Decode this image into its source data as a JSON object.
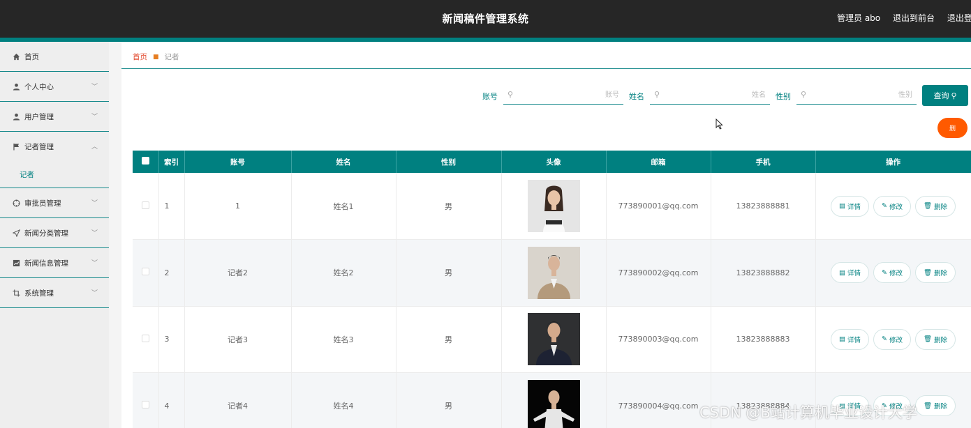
{
  "header": {
    "title": "新闻稿件管理系统",
    "user_label": "管理员 abo",
    "to_front_label": "退出到前台",
    "logout_label": "退出登录"
  },
  "sidebar": {
    "items": [
      {
        "label": "首页",
        "icon": "home-icon"
      },
      {
        "label": "个人中心",
        "icon": "user-icon"
      },
      {
        "label": "用户管理",
        "icon": "user-icon"
      },
      {
        "label": "记者管理",
        "icon": "flag-icon",
        "expanded": true,
        "children": [
          "记者"
        ]
      },
      {
        "label": "审批员管理",
        "icon": "target-icon"
      },
      {
        "label": "新闻分类管理",
        "icon": "send-icon"
      },
      {
        "label": "新闻信息管理",
        "icon": "chart-icon"
      },
      {
        "label": "系统管理",
        "icon": "crop-icon"
      }
    ]
  },
  "breadcrumb": {
    "home": "首页",
    "current": "记者"
  },
  "search": {
    "account_label": "账号",
    "account_placeholder": "账号",
    "name_label": "姓名",
    "name_placeholder": "姓名",
    "gender_label": "性别",
    "gender_placeholder": "性别",
    "query_label": "查询",
    "delete_label": "删"
  },
  "table": {
    "headers": [
      "索引",
      "账号",
      "姓名",
      "性别",
      "头像",
      "邮箱",
      "手机",
      "操作"
    ],
    "rows": [
      {
        "index": "1",
        "account": "1",
        "name": "姓名1",
        "gender": "男",
        "email": "773890001@qq.com",
        "phone": "13823888881"
      },
      {
        "index": "2",
        "account": "记者2",
        "name": "姓名2",
        "gender": "男",
        "email": "773890002@qq.com",
        "phone": "13823888882"
      },
      {
        "index": "3",
        "account": "记者3",
        "name": "姓名3",
        "gender": "男",
        "email": "773890003@qq.com",
        "phone": "13823888883"
      },
      {
        "index": "4",
        "account": "记者4",
        "name": "姓名4",
        "gender": "男",
        "email": "773890004@qq.com",
        "phone": "13823888884"
      }
    ],
    "actions": {
      "detail": "详情",
      "edit": "修改",
      "delete": "删除"
    }
  },
  "watermark": "CSDN @B站计算机毕业设计大学",
  "colors": {
    "accent": "#008080",
    "danger": "#ff5a00",
    "topbar": "#262626"
  }
}
